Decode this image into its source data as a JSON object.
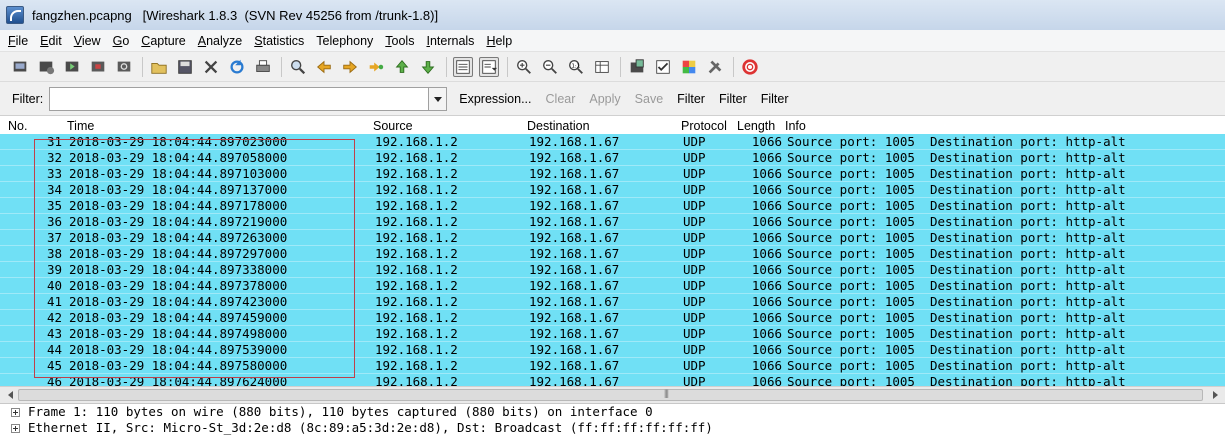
{
  "window": {
    "title": "fangzhen.pcapng   [Wireshark 1.8.3  (SVN Rev 45256 from /trunk-1.8)]"
  },
  "menu": [
    {
      "u": "F",
      "rest": "ile"
    },
    {
      "u": "E",
      "rest": "dit"
    },
    {
      "u": "V",
      "rest": "iew"
    },
    {
      "u": "G",
      "rest": "o"
    },
    {
      "u": "C",
      "rest": "apture"
    },
    {
      "u": "A",
      "rest": "nalyze"
    },
    {
      "u": "S",
      "rest": "tatistics"
    },
    {
      "u": "",
      "rest": "Telephony"
    },
    {
      "u": "T",
      "rest": "ools"
    },
    {
      "u": "I",
      "rest": "nternals"
    },
    {
      "u": "H",
      "rest": "elp"
    }
  ],
  "toolbar": {
    "icons": [
      "interface-list-icon",
      "capture-options-icon",
      "start-capture-icon",
      "stop-capture-icon",
      "restart-capture-icon",
      "open-file-icon",
      "save-file-icon",
      "close-file-icon",
      "reload-icon",
      "print-icon",
      "find-packet-icon",
      "go-back-icon",
      "go-forward-icon",
      "go-to-packet-icon",
      "go-first-icon",
      "go-last-icon",
      "colorize-icon",
      "auto-scroll-icon",
      "zoom-in-icon",
      "zoom-out-icon",
      "zoom-normal-icon",
      "resize-columns-icon",
      "capture-filters-icon",
      "display-filters-icon",
      "coloring-rules-icon",
      "preferences-icon",
      "help-icon"
    ]
  },
  "filter": {
    "label": "Filter:",
    "value": "",
    "expression": "Expression...",
    "clear": "Clear",
    "apply": "Apply",
    "save": "Save",
    "extra1": "Filter",
    "extra2": "Filter",
    "extra3": "Filter"
  },
  "columns": {
    "no": "No.",
    "time": "Time",
    "source": "Source",
    "destination": "Destination",
    "protocol": "Protocol",
    "length": "Length",
    "info": "Info"
  },
  "packets": [
    {
      "no": "31",
      "time": "2018-03-29 18:04:44.897023000",
      "src": "192.168.1.2",
      "dst": "192.168.1.67",
      "proto": "UDP",
      "len": "1066",
      "info": "Source port: 1005  Destination port: http-alt"
    },
    {
      "no": "32",
      "time": "2018-03-29 18:04:44.897058000",
      "src": "192.168.1.2",
      "dst": "192.168.1.67",
      "proto": "UDP",
      "len": "1066",
      "info": "Source port: 1005  Destination port: http-alt"
    },
    {
      "no": "33",
      "time": "2018-03-29 18:04:44.897103000",
      "src": "192.168.1.2",
      "dst": "192.168.1.67",
      "proto": "UDP",
      "len": "1066",
      "info": "Source port: 1005  Destination port: http-alt"
    },
    {
      "no": "34",
      "time": "2018-03-29 18:04:44.897137000",
      "src": "192.168.1.2",
      "dst": "192.168.1.67",
      "proto": "UDP",
      "len": "1066",
      "info": "Source port: 1005  Destination port: http-alt"
    },
    {
      "no": "35",
      "time": "2018-03-29 18:04:44.897178000",
      "src": "192.168.1.2",
      "dst": "192.168.1.67",
      "proto": "UDP",
      "len": "1066",
      "info": "Source port: 1005  Destination port: http-alt"
    },
    {
      "no": "36",
      "time": "2018-03-29 18:04:44.897219000",
      "src": "192.168.1.2",
      "dst": "192.168.1.67",
      "proto": "UDP",
      "len": "1066",
      "info": "Source port: 1005  Destination port: http-alt"
    },
    {
      "no": "37",
      "time": "2018-03-29 18:04:44.897263000",
      "src": "192.168.1.2",
      "dst": "192.168.1.67",
      "proto": "UDP",
      "len": "1066",
      "info": "Source port: 1005  Destination port: http-alt"
    },
    {
      "no": "38",
      "time": "2018-03-29 18:04:44.897297000",
      "src": "192.168.1.2",
      "dst": "192.168.1.67",
      "proto": "UDP",
      "len": "1066",
      "info": "Source port: 1005  Destination port: http-alt"
    },
    {
      "no": "39",
      "time": "2018-03-29 18:04:44.897338000",
      "src": "192.168.1.2",
      "dst": "192.168.1.67",
      "proto": "UDP",
      "len": "1066",
      "info": "Source port: 1005  Destination port: http-alt"
    },
    {
      "no": "40",
      "time": "2018-03-29 18:04:44.897378000",
      "src": "192.168.1.2",
      "dst": "192.168.1.67",
      "proto": "UDP",
      "len": "1066",
      "info": "Source port: 1005  Destination port: http-alt"
    },
    {
      "no": "41",
      "time": "2018-03-29 18:04:44.897423000",
      "src": "192.168.1.2",
      "dst": "192.168.1.67",
      "proto": "UDP",
      "len": "1066",
      "info": "Source port: 1005  Destination port: http-alt"
    },
    {
      "no": "42",
      "time": "2018-03-29 18:04:44.897459000",
      "src": "192.168.1.2",
      "dst": "192.168.1.67",
      "proto": "UDP",
      "len": "1066",
      "info": "Source port: 1005  Destination port: http-alt"
    },
    {
      "no": "43",
      "time": "2018-03-29 18:04:44.897498000",
      "src": "192.168.1.2",
      "dst": "192.168.1.67",
      "proto": "UDP",
      "len": "1066",
      "info": "Source port: 1005  Destination port: http-alt"
    },
    {
      "no": "44",
      "time": "2018-03-29 18:04:44.897539000",
      "src": "192.168.1.2",
      "dst": "192.168.1.67",
      "proto": "UDP",
      "len": "1066",
      "info": "Source port: 1005  Destination port: http-alt"
    },
    {
      "no": "45",
      "time": "2018-03-29 18:04:44.897580000",
      "src": "192.168.1.2",
      "dst": "192.168.1.67",
      "proto": "UDP",
      "len": "1066",
      "info": "Source port: 1005  Destination port: http-alt"
    },
    {
      "no": "46",
      "time": "2018-03-29 18:04:44.897624000",
      "src": "192.168.1.2",
      "dst": "192.168.1.67",
      "proto": "UDP",
      "len": "1066",
      "info": "Source port: 1005  Destination port: http-alt"
    }
  ],
  "details": [
    "Frame 1: 110 bytes on wire (880 bits), 110 bytes captured (880 bits) on interface 0",
    "Ethernet II, Src: Micro-St_3d:2e:d8 (8c:89:a5:3d:2e:d8), Dst: Broadcast (ff:ff:ff:ff:ff:ff)"
  ],
  "colors": {
    "row_bg": "#70e0f5",
    "selection_box": "#c0404a"
  }
}
